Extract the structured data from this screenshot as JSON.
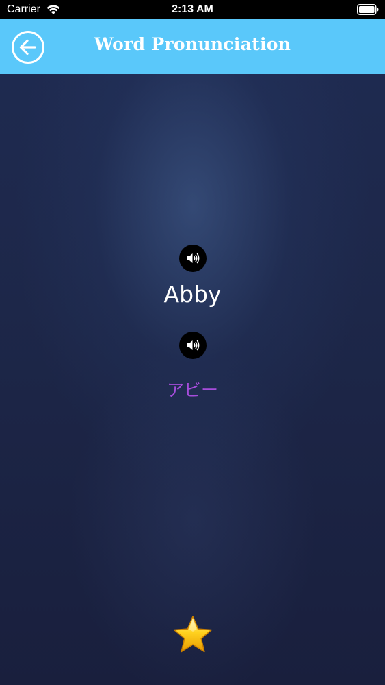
{
  "status_bar": {
    "carrier": "Carrier",
    "time": "2:13 AM",
    "wifi_icon": "wifi-icon",
    "battery_icon": "battery-icon"
  },
  "header": {
    "title": "Word Pronunciation",
    "back_icon": "arrow-left-circle-icon",
    "background_color": "#5ac8fa"
  },
  "word": {
    "text": "Abby",
    "speaker_icon": "speaker-icon"
  },
  "translation": {
    "text": "アビー",
    "speaker_icon": "speaker-icon",
    "color": "#a64ddb"
  },
  "favorite": {
    "icon": "star-icon",
    "color": "#f5b800"
  },
  "colors": {
    "divider": "#55c6e6",
    "background": "#1d2749"
  }
}
